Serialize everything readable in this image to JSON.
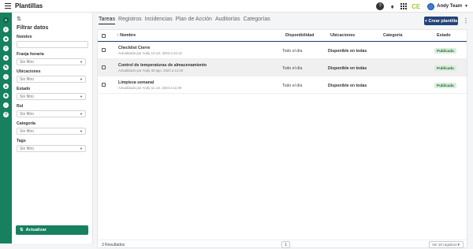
{
  "app": {
    "title": "Plantillas"
  },
  "header": {
    "user_name": "Andy Team",
    "logo_text": "CE"
  },
  "filters": {
    "title": "Filtrar datos",
    "fields": [
      {
        "label": "Nombre",
        "type": "input",
        "value": ""
      },
      {
        "label": "Franja horaria",
        "type": "select",
        "value": "Sin filtro"
      },
      {
        "label": "Ubicaciones",
        "type": "select",
        "value": "Sin filtro"
      },
      {
        "label": "Estado",
        "type": "select",
        "value": "Sin filtro"
      },
      {
        "label": "Rol",
        "type": "select",
        "value": "Sin filtro"
      },
      {
        "label": "Categoría",
        "type": "select",
        "value": "Sin filtro"
      },
      {
        "label": "Tags",
        "type": "select",
        "value": "Sin filtro"
      }
    ],
    "update_label": "Actualizar"
  },
  "tabs": [
    "Tareas",
    "Registros",
    "Incidencias",
    "Plan de Acción",
    "Auditorías",
    "Categorías"
  ],
  "create_label": "+ Crear plantilla",
  "table": {
    "headers": {
      "name": "Nombre",
      "disp": "Disponibilidad",
      "ubic": "Ubicaciones",
      "cat": "Categoría",
      "est": "Estado"
    },
    "rows": [
      {
        "name": "Checklist Cierre",
        "sub": "Actualizado por Andy 13 oct. 2024 a 22:13",
        "disp": "Todo el día",
        "ubic": "Disponible en todas",
        "cat": "",
        "status": "Publicada"
      },
      {
        "name": "Control de temperaturas de almacenamiento",
        "sub": "Actualizado por Andy 30 ago. 2023 a 12:40",
        "disp": "Todo el día",
        "ubic": "Disponible en todas",
        "cat": "",
        "status": "Publicada"
      },
      {
        "name": "Limpieza semanal",
        "sub": "Actualizado por Andy 11 oct. 2024 a 11:09",
        "disp": "Todo el día",
        "ubic": "Disponible en todas",
        "cat": "",
        "status": "Publicada"
      }
    ]
  },
  "footer": {
    "results": "3 Resultados",
    "page": "1",
    "per_page": "Ver 20 registros"
  }
}
